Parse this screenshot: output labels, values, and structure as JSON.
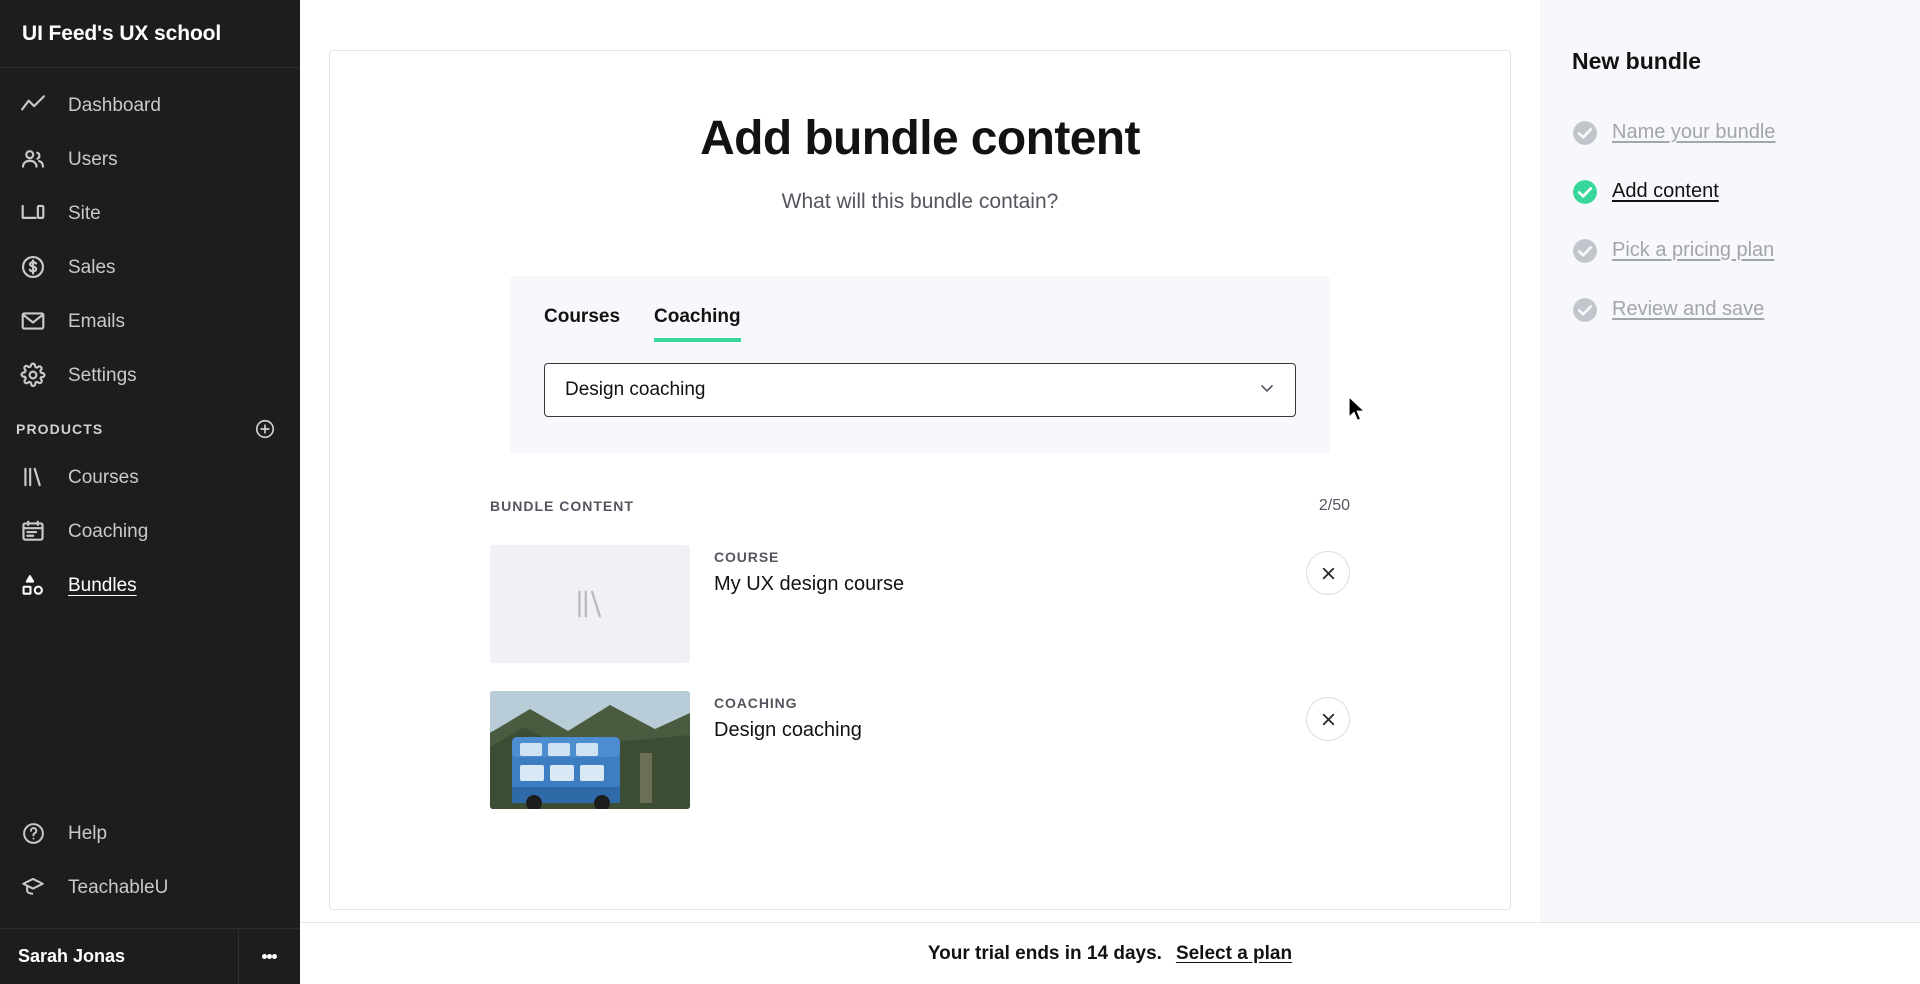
{
  "sidebar": {
    "brand": "UI Feed's UX school",
    "nav": [
      {
        "label": "Dashboard",
        "icon": "trend-line-icon"
      },
      {
        "label": "Users",
        "icon": "users-icon"
      },
      {
        "label": "Site",
        "icon": "devices-icon"
      },
      {
        "label": "Sales",
        "icon": "dollar-circle-icon"
      },
      {
        "label": "Emails",
        "icon": "envelope-icon"
      },
      {
        "label": "Settings",
        "icon": "gear-icon"
      }
    ],
    "products_label": "PRODUCTS",
    "products": [
      {
        "label": "Courses",
        "icon": "books-icon",
        "active": false
      },
      {
        "label": "Coaching",
        "icon": "calendar-icon",
        "active": false
      },
      {
        "label": "Bundles",
        "icon": "shapes-icon",
        "active": true
      }
    ],
    "bottom": [
      {
        "label": "Help",
        "icon": "question-circle-icon"
      },
      {
        "label": "TeachableU",
        "icon": "graduation-cap-icon"
      }
    ],
    "user": "Sarah Jonas"
  },
  "main": {
    "title": "Add bundle content",
    "subtitle": "What will this bundle contain?",
    "tabs": [
      {
        "label": "Courses",
        "active": false
      },
      {
        "label": "Coaching",
        "active": true
      }
    ],
    "select": {
      "value": "Design coaching"
    },
    "content_label": "BUNDLE CONTENT",
    "content_count": "2/50",
    "items": [
      {
        "kind": "COURSE",
        "title": "My UX design course",
        "thumb": "placeholder"
      },
      {
        "kind": "COACHING",
        "title": "Design coaching",
        "thumb": "photo-bus"
      }
    ]
  },
  "right": {
    "title": "New bundle",
    "steps": [
      {
        "label": "Name your bundle",
        "state": "done"
      },
      {
        "label": "Add content",
        "state": "current"
      },
      {
        "label": "Pick a pricing plan",
        "state": "todo"
      },
      {
        "label": "Review and save",
        "state": "todo"
      }
    ]
  },
  "footer": {
    "message": "Your trial ends in 14 days.",
    "link": "Select a plan"
  },
  "colors": {
    "accent_green": "#37d79b",
    "sidebar_bg": "#1d1d1d",
    "panel_bg": "#f7f8fb"
  }
}
